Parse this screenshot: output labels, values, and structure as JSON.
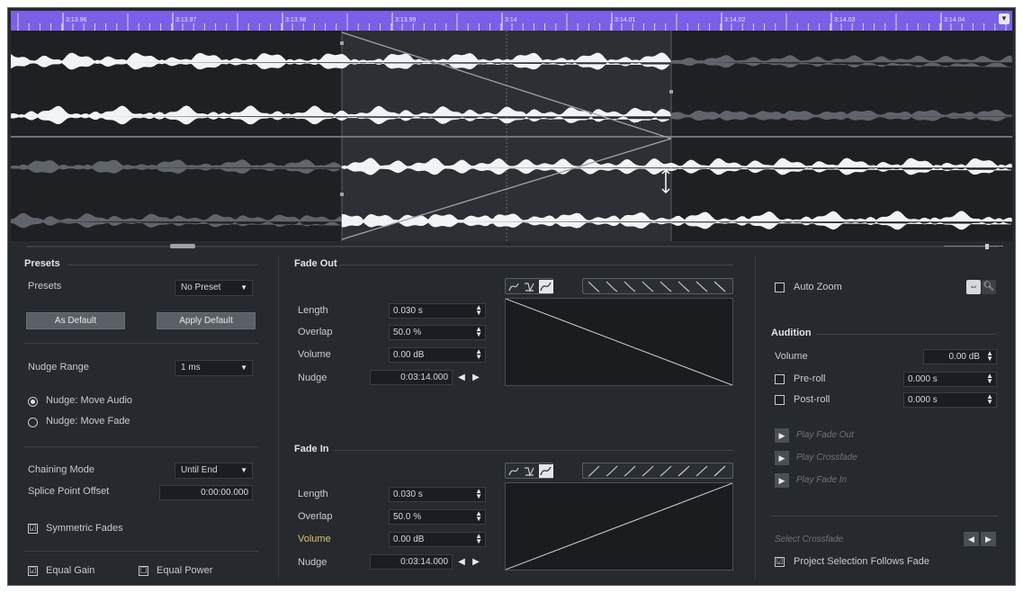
{
  "ruler": {
    "ticks": [
      "3:13.96",
      "3:13.97",
      "3:13.98",
      "3:13.99",
      "3:14",
      "3:14.01",
      "3:14.02",
      "3:14.03",
      "3:14.04"
    ],
    "menu_icon": "chevron-down-icon",
    "color": "#7b5fe6"
  },
  "presets": {
    "section_title": "Presets",
    "label": "Presets",
    "value": "No Preset",
    "as_default": "As Default",
    "apply_default": "Apply Default"
  },
  "nudge": {
    "range_label": "Nudge Range",
    "range_value": "1 ms",
    "move_audio": "Nudge: Move Audio",
    "move_fade": "Nudge: Move Fade",
    "selected": "move_audio"
  },
  "chaining": {
    "mode_label": "Chaining Mode",
    "mode_value": "Until End",
    "splice_label": "Splice Point Offset",
    "splice_value": "0:00:00.000",
    "symmetric_label": "Symmetric Fades",
    "symmetric_checked": "☑"
  },
  "gain": {
    "equal_gain_label": "Equal Gain",
    "equal_gain_checked": "☑",
    "equal_power_label": "Equal Power",
    "equal_power_checked": "☐"
  },
  "fade_out": {
    "title": "Fade Out",
    "length_label": "Length",
    "length_value": "0.030 s",
    "overlap_label": "Overlap",
    "overlap_value": "50.0 %",
    "volume_label": "Volume",
    "volume_value": "0.00 dB",
    "nudge_label": "Nudge",
    "nudge_value": "0:03:14.000"
  },
  "fade_in": {
    "title": "Fade In",
    "length_label": "Length",
    "length_value": "0.030 s",
    "overlap_label": "Overlap",
    "overlap_value": "50.0 %",
    "volume_label": "Volume",
    "volume_value": "0.00 dB",
    "nudge_label": "Nudge",
    "nudge_value": "0:03:14.000"
  },
  "right": {
    "auto_zoom_label": "Auto Zoom",
    "audition_title": "Audition",
    "volume_label": "Volume",
    "volume_value": "0.00 dB",
    "preroll_label": "Pre-roll",
    "preroll_value": "0.000 s",
    "postroll_label": "Post-roll",
    "postroll_value": "0.000 s",
    "play_fade_out": "Play Fade Out",
    "play_crossfade": "Play Crossfade",
    "play_fade_in": "Play Fade In",
    "select_crossfade": "Select Crossfade",
    "project_sel_label": "Project Selection Follows Fade",
    "project_sel_checked": "☑"
  }
}
